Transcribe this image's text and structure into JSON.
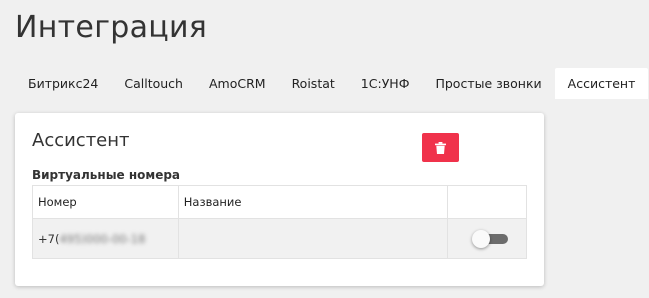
{
  "page": {
    "title": "Интеграция"
  },
  "tabs": [
    {
      "label": "Битрикс24",
      "active": false
    },
    {
      "label": "Calltouch",
      "active": false
    },
    {
      "label": "AmoCRM",
      "active": false
    },
    {
      "label": "Roistat",
      "active": false
    },
    {
      "label": "1С:УНФ",
      "active": false
    },
    {
      "label": "Простые звонки",
      "active": false
    },
    {
      "label": "Ассистент",
      "active": true
    }
  ],
  "card": {
    "title": "Ассистент",
    "delete_icon": "trash-icon",
    "delete_color": "#f0324b",
    "section_label": "Виртуальные номера",
    "table": {
      "columns": [
        "Номер",
        "Название",
        ""
      ],
      "rows": [
        {
          "number_prefix": "+7(",
          "number_hidden": "495)000-00-18",
          "name": "",
          "enabled": false
        }
      ]
    }
  }
}
